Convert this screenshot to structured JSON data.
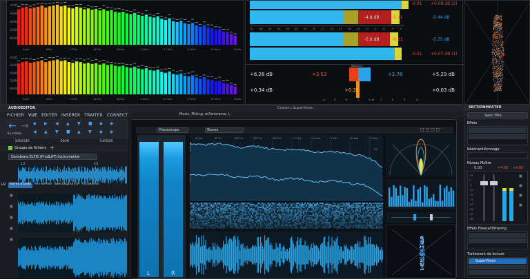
{
  "spectrum": {
    "freq_labels": [
      "44Hz",
      "86Hz",
      "171Hz",
      "342Hz",
      "684Hz",
      "1.4kHz",
      "2.7kHz",
      "5.5kHz",
      "10.9kHz",
      "20kHz"
    ],
    "db_labels_top": [
      "-20dB",
      "-30dB",
      "-40dB",
      "-50dB",
      "-60dB"
    ],
    "db_labels_bottom": [
      "-20dB",
      "-30dB",
      "-40dB",
      "-50dB",
      "-60dB"
    ],
    "bar_levels": [
      0.86,
      0.9,
      0.92,
      0.88,
      0.9,
      0.92,
      0.95,
      0.9,
      0.93,
      0.95,
      0.97,
      0.93,
      0.95,
      0.9,
      0.88,
      0.92,
      0.9,
      0.86,
      0.88,
      0.85,
      0.87,
      0.83,
      0.86,
      0.82,
      0.84,
      0.8,
      0.78,
      0.8,
      0.76,
      0.74,
      0.77,
      0.72,
      0.7,
      0.73,
      0.68,
      0.66,
      0.69,
      0.63,
      0.6,
      0.64,
      0.57,
      0.55,
      0.58,
      0.52,
      0.5,
      0.53,
      0.47,
      0.44,
      0.48,
      0.42,
      0.4,
      0.36,
      0.38,
      0.32,
      0.3,
      0.26,
      0.22
    ]
  },
  "level_meter": {
    "scale": [
      "-51",
      "-48",
      "-45",
      "-42",
      "-39",
      "-36",
      "-33",
      "-30",
      "-27",
      "-24",
      "-21",
      "-18",
      "-15",
      "-12",
      "-9",
      "-6",
      "-3",
      "0"
    ],
    "ch1_peak": "-4.8 dB",
    "ch1_right": "-0.01",
    "ch1_clip": "+0.08 dB (2)",
    "ch1_rms_a": "-5.31",
    "ch1_rms_b": "-5.44 dB",
    "ch2_peak": "-5.6 dB",
    "ch2_rms_a": "-6.23",
    "ch2_rms_b": "-5.75 dB",
    "ch2_right": "-0.01",
    "ch2_clip": "+0.07 dB (1)",
    "balance_title": "Balance",
    "row1_left": "+6.28 dB",
    "row1_mid_l": "+3.53",
    "row1_mid_r": "+2.78",
    "row1_right": "+5.29 dB",
    "row2_left": "+0.34 dB",
    "row2_mid": "+0.31",
    "row2_right": "+0.03 dB",
    "bottom_scale": [
      "-12",
      "-9",
      "-6",
      "-3",
      "0 dB",
      "3",
      "6",
      "9",
      "12"
    ]
  },
  "main": {
    "app_title": "AUDIOEDITOR",
    "menu_tabs": [
      "FICHIER",
      "VUE",
      "ÉDITER",
      "INSÉRER",
      "TRAITER",
      "CORRECT"
    ],
    "nav_back": "En arrière",
    "group_labels": [
      "NAVIGUER",
      "ZOOM",
      "CURSEUR"
    ],
    "file_group": "Groupe de fichiers",
    "file_tab": "Dansbana ELFIS (ProdLAT) Instrumental",
    "view_tabs": [
      "Forme d'onde",
      "Arc-en-ciel",
      "Spectrogramme",
      "Ondelettes"
    ],
    "track_mark_1": "1:2",
    "track_mark_2": "3:5",
    "lr": "LR"
  },
  "supervision": {
    "window_title": "Custom: SuperVision",
    "top_tabs": "Music, Mixing, w.Panorama, L",
    "module_a": "Phasescope",
    "module_b": "Stereo",
    "meter_l": "L",
    "meter_r": "R",
    "hz_labels": [
      "40 Hz",
      "80 Hz",
      "160 Hz",
      "320 Hz",
      "640 Hz",
      "1.2 kHz",
      "2.5 kHz",
      "5 kHz",
      "10 kHz",
      "20 kHz"
    ],
    "db_labels": [
      "-20",
      "-40",
      "-60"
    ]
  },
  "right_panel": {
    "title": "SECTIONMASTER",
    "preset": "Sans Titre",
    "effets": "Effets",
    "resampling": "Rééchantillonnage",
    "niveau_maitre": "Niveau Maître",
    "nm_a": "0.00",
    "nm_b": "+4.00",
    "nm_c": "+4.00",
    "finaux": "Effets Finaux/Dithering",
    "traitement": "Traitement de lecture",
    "supervision_item": "SuperVision",
    "scale": [
      "+6",
      "0",
      "-6",
      "-12",
      "-18",
      "-24",
      "-30",
      "-36",
      "-42",
      "-48"
    ],
    "colors": {
      "accent": "#1d6fbd",
      "highlight": "#1e90ff"
    }
  }
}
